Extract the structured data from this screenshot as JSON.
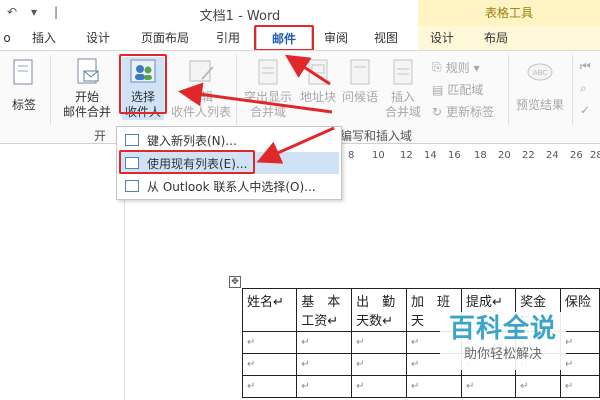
{
  "window": {
    "title": "文档1 - Word",
    "table_tools": "表格工具"
  },
  "tabs": [
    {
      "label": "o"
    },
    {
      "label": "插入"
    },
    {
      "label": "设计"
    },
    {
      "label": "页面布局"
    },
    {
      "label": "引用"
    },
    {
      "label": "邮件",
      "active": true
    },
    {
      "label": "审阅"
    },
    {
      "label": "视图"
    },
    {
      "label": "设计"
    },
    {
      "label": "布局"
    }
  ],
  "ribbon": {
    "labels_button": "标签",
    "start_merge_line1": "开始",
    "start_merge_line2": "邮件合并",
    "select_recipients_line1": "选择",
    "select_recipients_line2": "收件人",
    "edit_recipients_line1": "编辑",
    "edit_recipients_line2": "收件人列表",
    "highlight_fields_line1": "突出显示",
    "highlight_fields_line2": "合并域",
    "address_block": "地址块",
    "greeting_line": "问候语",
    "insert_field_line1": "插入",
    "insert_field_line2": "合并域",
    "rules": "规则",
    "match_fields": "匹配域",
    "update_labels": "更新标签",
    "preview_results": "预览结果",
    "group_start_prefix": "开",
    "group_write_insert": "编写和插入域"
  },
  "dropdown": {
    "items": [
      {
        "label": "键入新列表(N)..."
      },
      {
        "label": "使用现有列表(E)...",
        "selected": true
      },
      {
        "label": "从 Outlook 联系人中选择(O)..."
      }
    ]
  },
  "ruler": [
    "8",
    "10",
    "12",
    "14",
    "16",
    "18",
    "20",
    "22",
    "24",
    "26",
    "28"
  ],
  "table": {
    "headers": [
      [
        "姓名↵",
        ""
      ],
      [
        "基　本",
        "工资↵"
      ],
      [
        "出　勤",
        "天数↵"
      ],
      [
        "加　班",
        "天"
      ],
      [
        "提成↵",
        ""
      ],
      [
        "奖金↵",
        ""
      ],
      [
        "保险",
        ""
      ]
    ],
    "cell_mark": "↵"
  },
  "watermark": {
    "title": "百科全说",
    "subtitle": "助你轻松解决"
  },
  "colors": {
    "accent_blue": "#1e5fb5",
    "highlight_red": "#e0282b",
    "table_tools_bg": "#fff4c4",
    "selected_item": "#cfe2f6"
  }
}
